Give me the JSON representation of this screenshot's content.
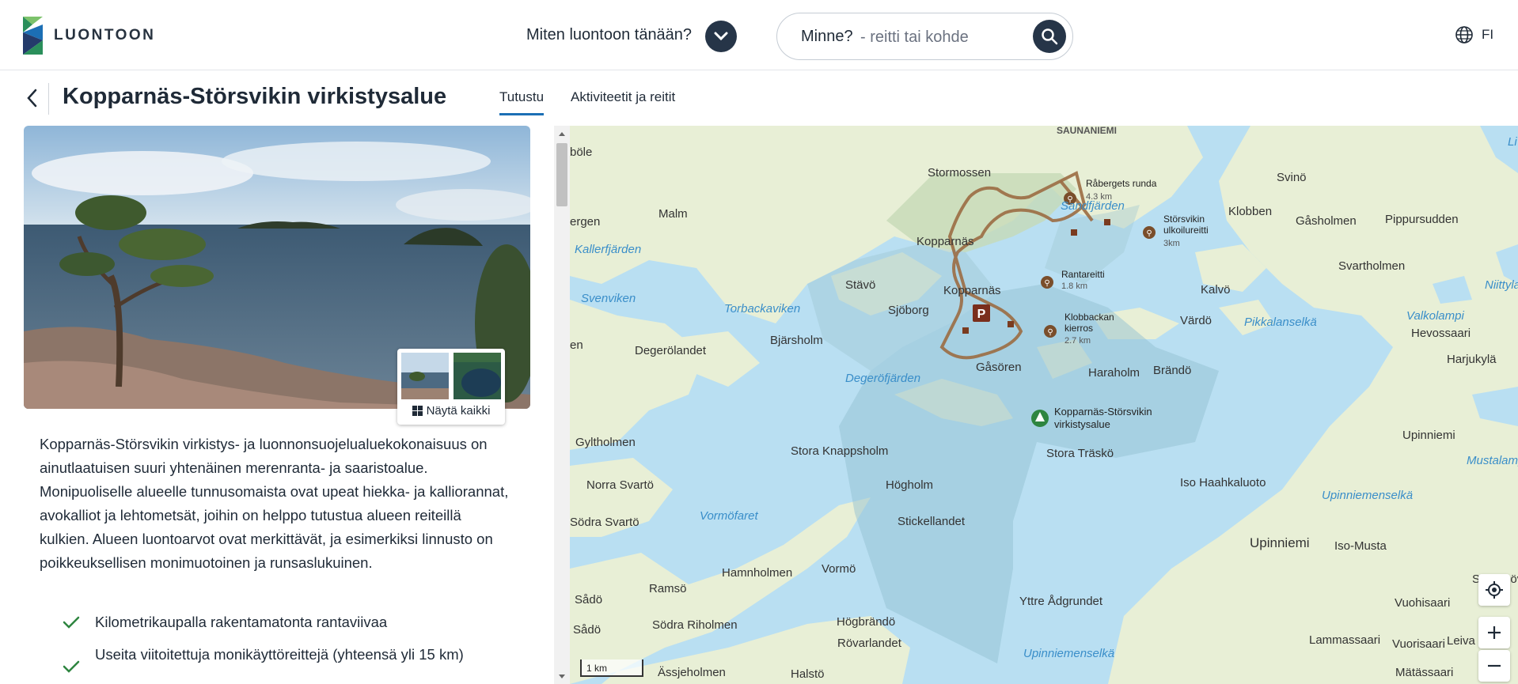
{
  "header": {
    "logo_text": "LUONTOON",
    "activity_question": "Miten luontoon tänään?",
    "search_label": "Minne?",
    "search_placeholder": "- reitti tai kohde",
    "language": "FI"
  },
  "page": {
    "title": "Kopparnäs-Störsvikin virkistysalue",
    "tabs": [
      {
        "label": "Tutustu",
        "active": true
      },
      {
        "label": "Aktiviteetit ja reitit",
        "active": false
      }
    ]
  },
  "gallery": {
    "show_all_label": "Näytä kaikki"
  },
  "description": "Kopparnäs-Störsvikin virkistys- ja luonnonsuojelualuekokonaisuus on ainutlaatuisen suuri yhtenäinen merenranta- ja saaristoalue. Monipuoliselle alueelle tunnusomaista ovat upeat hiekka- ja kalliorannat, avokalliot ja lehtometsät, joihin on helppo tutustua alueen reiteillä kulkien. Alueen luontoarvot ovat merkittävät, ja esimerkiksi linnusto on poikkeuksellisen monimuotoinen ja runsaslukuinen.",
  "features": [
    "Kilometrikaupalla rakentamatonta rantaviivaa",
    "Useita viitoitettuja monikäyttöreittejä (yhteensä yli 15 km)"
  ],
  "map": {
    "scale_label": "1 km",
    "place_labels": [
      "SAUNANIEMI",
      "böle",
      "Stormossen",
      "Malm",
      "Kopparnäs",
      "Kopparnäs",
      "Stävö",
      "Sjöborg",
      "Bjärsholm",
      "Degerölandet",
      "Gåsören",
      "Haraholm",
      "Brändö",
      "Gyltholmen",
      "Stora Knappsholm",
      "Stora Träskö",
      "Norra Svartö",
      "Högholm",
      "Iso Haahkaluoto",
      "Stickellandet",
      "Södra Svartö",
      "Hamnholmen",
      "Vormö",
      "Ramsö",
      "Sådö",
      "Sådö",
      "Södra Riholmen",
      "Högbrändö",
      "Rövarlandet",
      "Yttre Ådgrundet",
      "Ässjeholmen",
      "Halstö",
      "ergen",
      "en",
      "Svinö",
      "Klobben",
      "Gåsholmen",
      "Pippursudden",
      "Svartholmen",
      "Kalvö",
      "Värdö",
      "Hevossaari",
      "Harjukylä",
      "Upinniemi",
      "Upinniemi",
      "Iso-Musta",
      "Vuohisaari",
      "Lammassaari",
      "Vuorisaari",
      "Leiva",
      "Mätässaari",
      "Stora Lövö"
    ],
    "water_labels": [
      "Kallerfjärden",
      "Svenviken",
      "Torbackaviken",
      "Sandfjärden",
      "Degeröfjärden",
      "Vormöfaret",
      "Upinniemenselkä",
      "Pikkalanselkä",
      "Valkolampi",
      "Niittylam",
      "Mustalampi",
      "Upinniemenselkä",
      "Li"
    ],
    "routes": [
      {
        "name": "Råbergets runda",
        "length": "4.3 km"
      },
      {
        "name": "Störsvikin ulkoilureitti",
        "length": "3km"
      },
      {
        "name": "Rantareitti",
        "length": "1.8 km"
      },
      {
        "name": "Klobbackan kierros",
        "length": "2.7 km"
      }
    ],
    "area_label": "Kopparnäs-Störsvikin virkistysalue",
    "parking_label": "P"
  },
  "colors": {
    "primary_dark": "#263548",
    "accent_blue": "#1c6fb5",
    "check_green": "#2e8540",
    "route_brown": "#9b6b43",
    "land": "#e8efd6",
    "water": "#b9dff2"
  }
}
